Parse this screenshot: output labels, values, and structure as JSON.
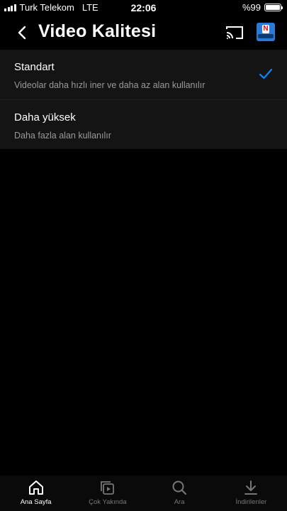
{
  "status_bar": {
    "carrier": "Turk Telekom",
    "network": "LTE",
    "time": "22:06",
    "battery": "%99",
    "battery_level": 0.99
  },
  "header": {
    "title": "Video Kalitesi",
    "back_icon": "chevron-left-icon",
    "cast_icon": "cast-icon",
    "avatar_letter": "N"
  },
  "options": [
    {
      "title": "Standart",
      "description": "Videolar daha hızlı iner ve daha az alan kullanılır",
      "selected": true
    },
    {
      "title": "Daha yüksek",
      "description": "Daha fazla alan kullanılır",
      "selected": false
    }
  ],
  "colors": {
    "accent": "#0a84ff",
    "background": "#000000",
    "row_background": "#141414"
  },
  "tab_bar": {
    "tabs": [
      {
        "label": "Ana Sayfa",
        "icon": "home-icon",
        "active": true
      },
      {
        "label": "Çok Yakında",
        "icon": "coming-soon-icon",
        "active": false
      },
      {
        "label": "Ara",
        "icon": "search-icon",
        "active": false
      },
      {
        "label": "İndirilenler",
        "icon": "download-icon",
        "active": false
      }
    ]
  }
}
